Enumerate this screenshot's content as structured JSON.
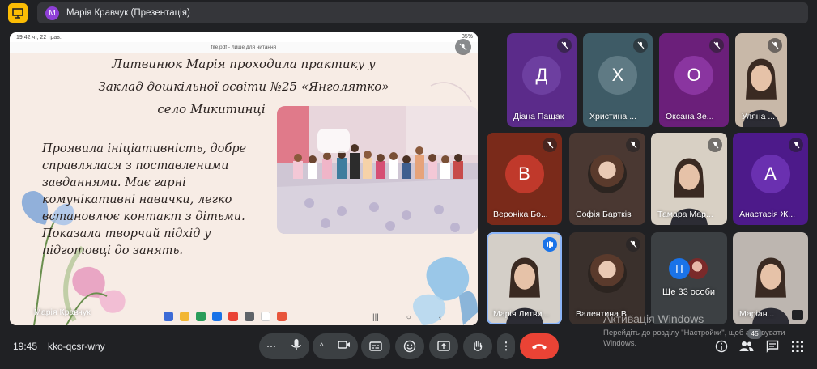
{
  "window": {
    "title": "Марія Кравчук (Презентація)",
    "avatar_letter": "М"
  },
  "presentation": {
    "status_time": "19:42  чт, 22 трав.",
    "status_right": "35%",
    "file_label": "file.pdf - лише для читання",
    "slide_line1": "Литвинюк Марія проходила практику у",
    "slide_line2": "Заклад дошкільної освіти №25 «Янголятко»",
    "slide_line3": "село Микитинці",
    "slide_body": "Проявила ініціативність, добре справлялася з поставленими завданнями. Має гарні комунікативні навички, легко встановлює контакт з дітьми. Показала творчий підхід у підготовці до занять.",
    "presenter_name": "Марія Кравчук"
  },
  "participants": [
    {
      "name": "Діана Пащак",
      "letter": "Д",
      "bg": "#5b2b8a",
      "circle": "#6d3fa0",
      "kind": "letter"
    },
    {
      "name": "Христина ...",
      "letter": "Х",
      "bg": "#3e5b66",
      "circle": "#5f7a84",
      "kind": "letter"
    },
    {
      "name": "Оксана Зе...",
      "letter": "О",
      "bg": "#6b1f7a",
      "circle": "#8a35a0",
      "kind": "letter"
    },
    {
      "name": "Уляна ...",
      "kind": "video",
      "bg": "#c8b8a8"
    },
    {
      "name": "Вероніка Бо...",
      "letter": "В",
      "bg": "#7a2a1a",
      "circle": "#c0392b",
      "kind": "letter"
    },
    {
      "name": "Софія Бартків",
      "kind": "photo",
      "bg": "#4a3832"
    },
    {
      "name": "Тамара Мар...",
      "kind": "video",
      "bg": "#d8d0c4"
    },
    {
      "name": "Анастасія Ж...",
      "letter": "А",
      "bg": "#4d1a8a",
      "circle": "#6a30b0",
      "kind": "letter"
    },
    {
      "name": "Марія Литви...",
      "kind": "video",
      "bg": "#d4cfc8"
    },
    {
      "name": "Валентина В...",
      "kind": "photo",
      "bg": "#3a302c"
    },
    {
      "name": "Ще 33 особи",
      "kind": "more",
      "bg": "#3c4043"
    },
    {
      "name": "Маріан...",
      "kind": "video",
      "bg": "#bdb6b0"
    }
  ],
  "more_tile": {
    "avatar1_letter": "Н"
  },
  "watermark": {
    "line1": "Активація Windows",
    "line2": "Перейдіть до розділу \"Настройки\", щоб активувати Windows."
  },
  "bottom": {
    "time": "19:45",
    "meeting_code": "kko-qcsr-wny",
    "participants_count": "45"
  }
}
